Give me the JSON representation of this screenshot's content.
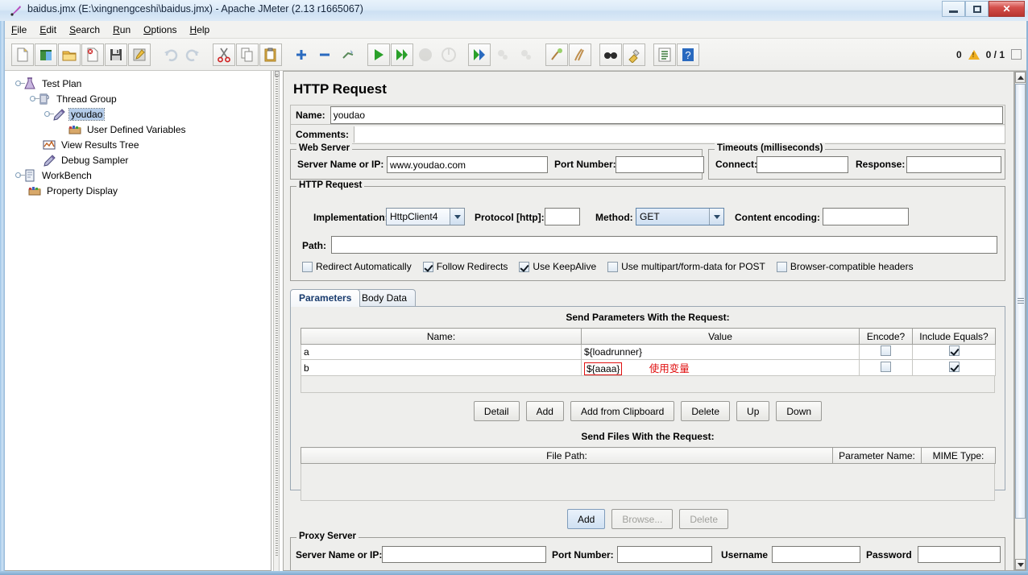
{
  "window": {
    "title": "baidus.jmx (E:\\xingnengceshi\\baidus.jmx) - Apache JMeter (2.13 r1665067)",
    "minimize_label": "Minimize",
    "maximize_label": "Maximize",
    "close_label": "✕"
  },
  "menu": [
    {
      "label": "File",
      "mnemonic": "F"
    },
    {
      "label": "Edit",
      "mnemonic": "E"
    },
    {
      "label": "Search",
      "mnemonic": "S"
    },
    {
      "label": "Run",
      "mnemonic": "R"
    },
    {
      "label": "Options",
      "mnemonic": "O"
    },
    {
      "label": "Help",
      "mnemonic": "H"
    }
  ],
  "toolbar": {
    "buttons": [
      {
        "name": "new-icon",
        "enabled": true
      },
      {
        "name": "templates-icon",
        "enabled": true
      },
      {
        "name": "open-icon",
        "enabled": true
      },
      {
        "name": "close-icon",
        "enabled": true
      },
      {
        "name": "save-icon",
        "enabled": true
      },
      {
        "name": "save-as-icon",
        "enabled": true
      },
      {
        "name": "undo-icon",
        "enabled": false
      },
      {
        "name": "redo-icon",
        "enabled": false
      },
      {
        "name": "cut-icon",
        "enabled": true
      },
      {
        "name": "copy-icon",
        "enabled": true
      },
      {
        "name": "paste-icon",
        "enabled": true
      },
      {
        "name": "expand-all-icon",
        "enabled": true
      },
      {
        "name": "collapse-all-icon",
        "enabled": true
      },
      {
        "name": "toggle-icon",
        "enabled": true
      },
      {
        "name": "start-icon",
        "enabled": true
      },
      {
        "name": "start-no-pauses-icon",
        "enabled": true
      },
      {
        "name": "stop-icon",
        "enabled": false
      },
      {
        "name": "shutdown-icon",
        "enabled": false
      },
      {
        "name": "start-remote-icon",
        "enabled": true
      },
      {
        "name": "stop-remote-icon",
        "enabled": false
      },
      {
        "name": "shutdown-remote-icon",
        "enabled": false
      },
      {
        "name": "clear-icon",
        "enabled": true
      },
      {
        "name": "clear-all-icon",
        "enabled": true
      },
      {
        "name": "search-icon",
        "enabled": true
      },
      {
        "name": "reset-search-icon",
        "enabled": true
      },
      {
        "name": "function-helper-icon",
        "enabled": true
      },
      {
        "name": "help-icon",
        "enabled": true
      }
    ],
    "warning_count": "0",
    "thread_counter": "0 / 1"
  },
  "tree": {
    "nodes": [
      {
        "label": "Test Plan",
        "depth": 0,
        "icon": "test-plan-icon",
        "selected": false,
        "expandable": true
      },
      {
        "label": "Thread Group",
        "depth": 1,
        "icon": "thread-group-icon",
        "selected": false,
        "expandable": true
      },
      {
        "label": "youdao",
        "depth": 2,
        "icon": "http-sampler-icon",
        "selected": true,
        "expandable": true
      },
      {
        "label": "User Defined Variables",
        "depth": 3,
        "icon": "user-defined-variables-icon",
        "selected": false,
        "expandable": false
      },
      {
        "label": "View Results Tree",
        "depth": 2,
        "icon": "view-results-tree-icon",
        "selected": false,
        "expandable": false
      },
      {
        "label": "Debug Sampler",
        "depth": 2,
        "icon": "debug-sampler-icon",
        "selected": false,
        "expandable": false
      },
      {
        "label": "WorkBench",
        "depth": 0,
        "icon": "workbench-icon",
        "selected": false,
        "expandable": true
      },
      {
        "label": "Property Display",
        "depth": 1,
        "icon": "property-display-icon",
        "selected": false,
        "expandable": false
      }
    ]
  },
  "main": {
    "title": "HTTP Request",
    "name_label": "Name:",
    "name_value": "youdao",
    "comments_label": "Comments:",
    "comments_value": "",
    "web_server": {
      "legend": "Web Server",
      "server_label": "Server Name or IP:",
      "server_value": "www.youdao.com",
      "port_label": "Port Number:",
      "port_value": ""
    },
    "timeouts": {
      "legend": "Timeouts (milliseconds)",
      "connect_label": "Connect:",
      "connect_value": "",
      "response_label": "Response:",
      "response_value": ""
    },
    "http_request": {
      "legend": "HTTP Request",
      "implementation_label": "Implementation:",
      "implementation_value": "HttpClient4",
      "protocol_label": "Protocol [http]:",
      "protocol_value": "",
      "method_label": "Method:",
      "method_value": "GET",
      "content_encoding_label": "Content encoding:",
      "content_encoding_value": "",
      "path_label": "Path:",
      "path_value": ""
    },
    "options": [
      {
        "label": "Redirect Automatically",
        "checked": false
      },
      {
        "label": "Follow Redirects",
        "checked": true
      },
      {
        "label": "Use KeepAlive",
        "checked": true
      },
      {
        "label": "Use multipart/form-data for POST",
        "checked": false
      },
      {
        "label": "Browser-compatible headers",
        "checked": false
      }
    ],
    "tabs": [
      {
        "label": "Parameters",
        "active": true
      },
      {
        "label": "Body Data",
        "active": false
      }
    ],
    "parameters": {
      "caption": "Send Parameters With the Request:",
      "columns": [
        "Name:",
        "Value",
        "Encode?",
        "Include Equals?"
      ],
      "rows": [
        {
          "name": "a",
          "value": "${loadrunner}",
          "encode": false,
          "include_equals": true,
          "annotated": false
        },
        {
          "name": "b",
          "value": "${aaaa}",
          "encode": false,
          "include_equals": true,
          "annotated": true
        }
      ],
      "annotation_text": "使用变量",
      "annotation_color": "#e01010",
      "buttons": [
        {
          "label": "Detail",
          "enabled": true
        },
        {
          "label": "Add",
          "enabled": true
        },
        {
          "label": "Add from Clipboard",
          "enabled": true
        },
        {
          "label": "Delete",
          "enabled": true
        },
        {
          "label": "Up",
          "enabled": true
        },
        {
          "label": "Down",
          "enabled": true
        }
      ]
    },
    "files": {
      "caption": "Send Files With the Request:",
      "columns": [
        "File Path:",
        "Parameter Name:",
        "MIME Type:"
      ],
      "rows": [],
      "buttons": [
        {
          "label": "Add",
          "enabled": true,
          "primary": true
        },
        {
          "label": "Browse...",
          "enabled": false,
          "primary": false
        },
        {
          "label": "Delete",
          "enabled": false,
          "primary": false
        }
      ]
    },
    "proxy_server": {
      "legend": "Proxy Server",
      "server_label": "Server Name or IP:",
      "server_value": "",
      "port_label": "Port Number:",
      "port_value": "",
      "username_label": "Username",
      "username_value": "",
      "password_label": "Password",
      "password_value": ""
    }
  }
}
